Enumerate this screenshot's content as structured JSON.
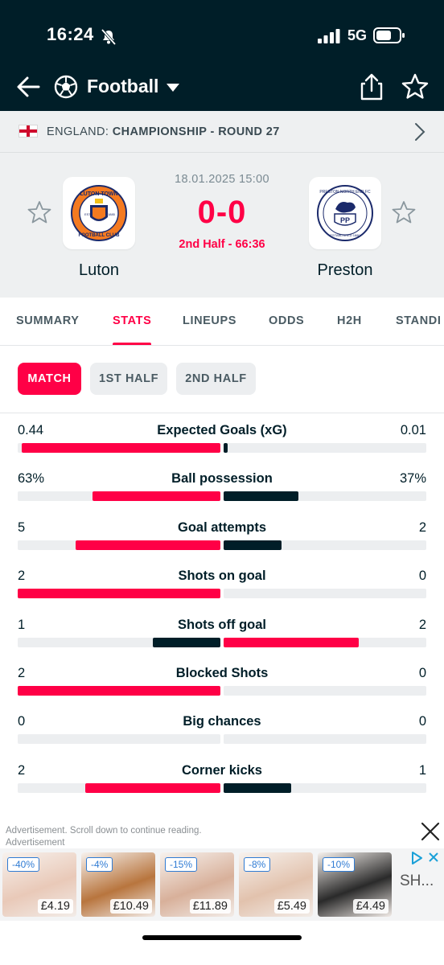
{
  "status_bar": {
    "time": "16:24",
    "network": "5G"
  },
  "app_bar": {
    "title": "Football"
  },
  "league": {
    "country": "ENGLAND:",
    "competition": "CHAMPIONSHIP - ROUND 27"
  },
  "match": {
    "date": "18.01.2025 15:00",
    "score": "0-0",
    "status": "2nd Half - 66:36",
    "home_team": "Luton",
    "away_team": "Preston",
    "home_crest_text": [
      "LUTON TOWN",
      "FOOTBALL CLUB",
      "EST",
      "1885"
    ],
    "away_crest_text": [
      "PRESTON NORTH END FC",
      "PP",
      "ESTABLISHED 1880"
    ]
  },
  "tabs": [
    {
      "label": "SUMMARY",
      "active": false
    },
    {
      "label": "STATS",
      "active": true
    },
    {
      "label": "LINEUPS",
      "active": false
    },
    {
      "label": "ODDS",
      "active": false
    },
    {
      "label": "H2H",
      "active": false
    },
    {
      "label": "STANDI",
      "active": false
    }
  ],
  "periods": [
    {
      "label": "MATCH",
      "active": true
    },
    {
      "label": "1ST HALF",
      "active": false
    },
    {
      "label": "2ND HALF",
      "active": false
    }
  ],
  "colors": {
    "accent": "#ff0046",
    "dark": "#001e28",
    "track": "#eceef0"
  },
  "stats": [
    {
      "label": "Expected Goals (xG)",
      "home": "0.44",
      "away": "0.01",
      "home_share": 0.98,
      "away_share": 0.02
    },
    {
      "label": "Ball possession",
      "home": "63%",
      "away": "37%",
      "home_share": 0.63,
      "away_share": 0.37
    },
    {
      "label": "Goal attempts",
      "home": "5",
      "away": "2",
      "home_share": 0.714,
      "away_share": 0.286
    },
    {
      "label": "Shots on goal",
      "home": "2",
      "away": "0",
      "home_share": 1.0,
      "away_share": 0.0
    },
    {
      "label": "Shots off goal",
      "home": "1",
      "away": "2",
      "home_share": 0.333,
      "away_share": 0.667
    },
    {
      "label": "Blocked Shots",
      "home": "2",
      "away": "0",
      "home_share": 1.0,
      "away_share": 0.0
    },
    {
      "label": "Big chances",
      "home": "0",
      "away": "0",
      "home_share": 0.0,
      "away_share": 0.0
    },
    {
      "label": "Corner kicks",
      "home": "2",
      "away": "1",
      "home_share": 0.667,
      "away_share": 0.333
    }
  ],
  "ad": {
    "note": "Advertisement. Scroll down to continue reading.",
    "label": "Advertisement",
    "cta": "SH...",
    "products": [
      {
        "discount": "-40%",
        "price": "£4.19",
        "color": "#e9c9b8"
      },
      {
        "discount": "-4%",
        "price": "£10.49",
        "color": "#b8753e"
      },
      {
        "discount": "-15%",
        "price": "£11.89",
        "color": "#d8b09a"
      },
      {
        "discount": "-8%",
        "price": "£5.49",
        "color": "#e2c2ad"
      },
      {
        "discount": "-10%",
        "price": "£4.49",
        "color": "#2a2a2a"
      }
    ]
  }
}
